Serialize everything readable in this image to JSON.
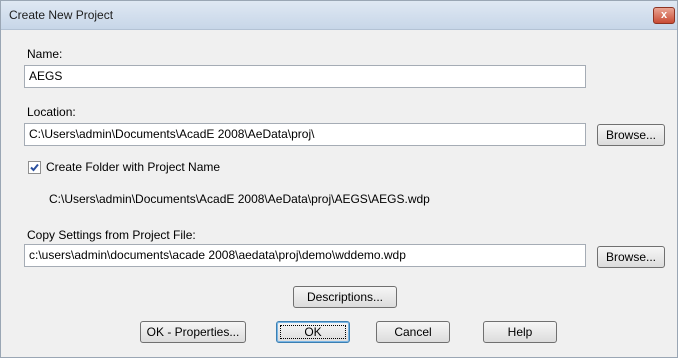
{
  "window": {
    "title": "Create New Project",
    "close_glyph": "x"
  },
  "name": {
    "label": "Name:",
    "value": "AEGS"
  },
  "location": {
    "label": "Location:",
    "value": "C:\\Users\\admin\\Documents\\AcadE 2008\\AeData\\proj\\",
    "browse_label": "Browse..."
  },
  "create_folder": {
    "label": "Create Folder with Project Name",
    "checked": true,
    "path": "C:\\Users\\admin\\Documents\\AcadE 2008\\AeData\\proj\\AEGS\\AEGS.wdp"
  },
  "copy_settings": {
    "label": "Copy Settings from Project File:",
    "value": "c:\\users\\admin\\documents\\acade 2008\\aedata\\proj\\demo\\wddemo.wdp",
    "browse_label": "Browse..."
  },
  "buttons": {
    "descriptions": "Descriptions...",
    "ok_properties": "OK - Properties...",
    "ok": "OK",
    "cancel": "Cancel",
    "help": "Help"
  },
  "colors": {
    "checkmark": "#2a4f9e",
    "titlebar_close": "#c94b34",
    "default_button_border": "#3c7fb1"
  },
  "icons": {
    "close": "close-icon",
    "checkbox": "checkmark-icon"
  }
}
